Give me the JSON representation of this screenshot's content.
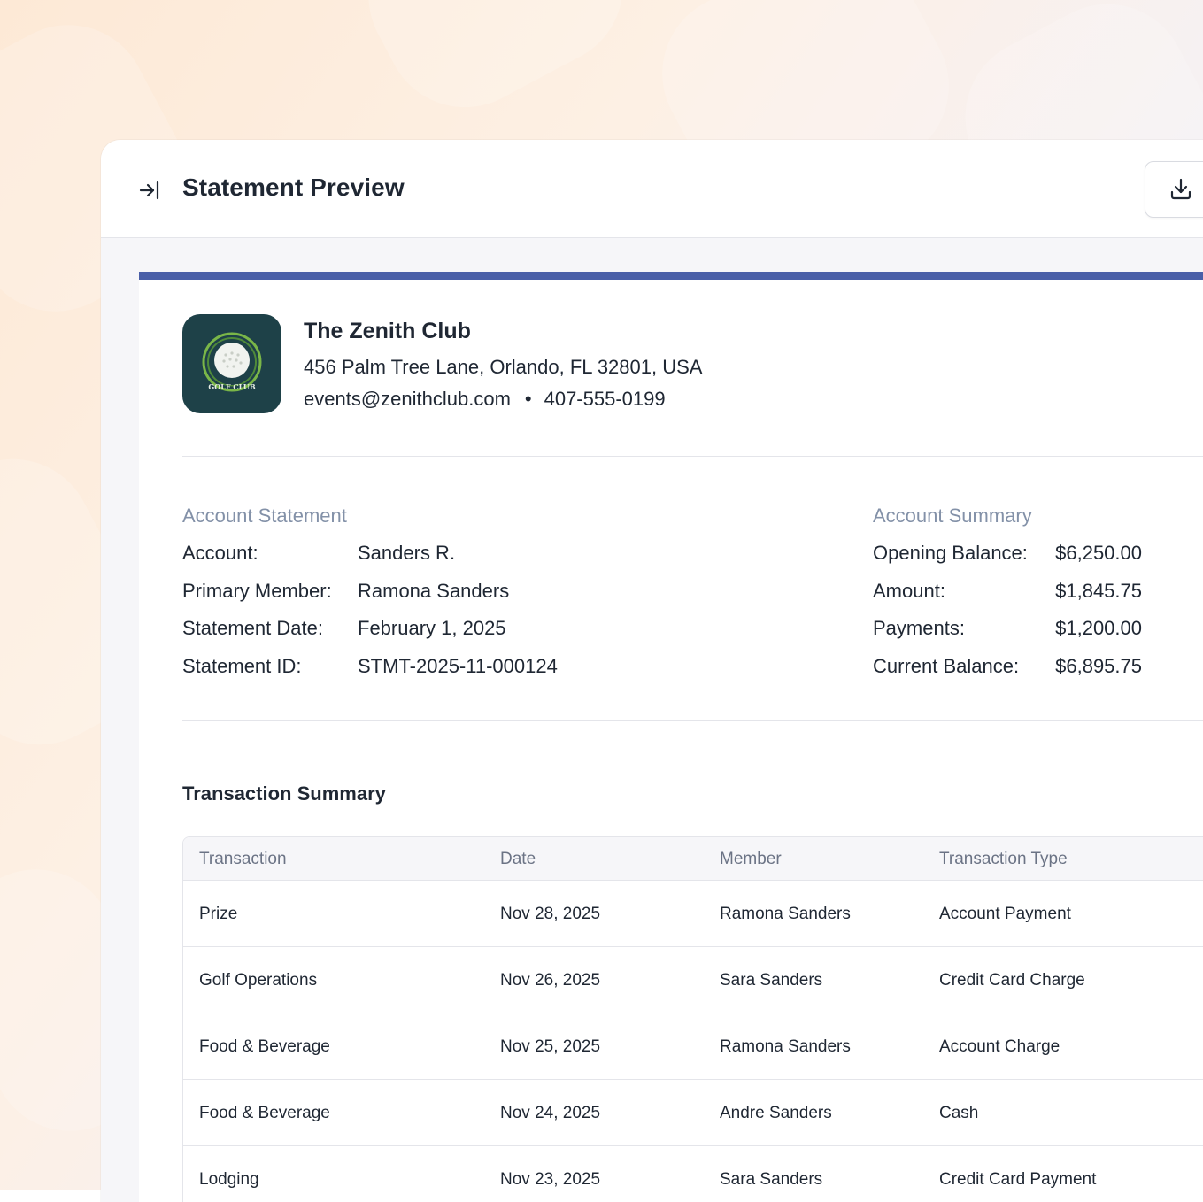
{
  "header": {
    "title": "Statement Preview"
  },
  "club": {
    "name": "The Zenith Club",
    "address": "456 Palm Tree Lane, Orlando, FL 32801, USA",
    "email": "events@zenithclub.com",
    "separator": "•",
    "phone": "407-555-0199",
    "logo_text": "GOLF CLUB"
  },
  "statement": {
    "label": "Account Statement",
    "rows": [
      {
        "key": "Account:",
        "value": "Sanders R."
      },
      {
        "key": "Primary Member:",
        "value": "Ramona Sanders"
      },
      {
        "key": "Statement Date:",
        "value": "February 1, 2025"
      },
      {
        "key": "Statement ID:",
        "value": "STMT-2025-11-000124"
      }
    ]
  },
  "summary": {
    "label": "Account Summary",
    "rows": [
      {
        "key": "Opening Balance:",
        "value": "$6,250.00"
      },
      {
        "key": "Amount:",
        "value": "$1,845.75"
      },
      {
        "key": "Payments:",
        "value": "$1,200.00"
      },
      {
        "key": "Current Balance:",
        "value": "$6,895.75"
      }
    ]
  },
  "transactions": {
    "title": "Transaction Summary",
    "columns": [
      "Transaction",
      "Date",
      "Member",
      "Transaction Type"
    ],
    "rows": [
      {
        "transaction": "Prize",
        "date": "Nov 28, 2025",
        "member": "Ramona Sanders",
        "type": "Account Payment"
      },
      {
        "transaction": "Golf Operations",
        "date": "Nov 26, 2025",
        "member": "Sara Sanders",
        "type": "Credit Card Charge"
      },
      {
        "transaction": "Food & Beverage",
        "date": "Nov 25, 2025",
        "member": "Ramona Sanders",
        "type": "Account Charge"
      },
      {
        "transaction": "Food & Beverage",
        "date": "Nov 24, 2025",
        "member": "Andre Sanders",
        "type": "Cash"
      },
      {
        "transaction": "Lodging",
        "date": "Nov 23, 2025",
        "member": "Sara Sanders",
        "type": "Credit Card Payment"
      }
    ]
  },
  "icons": {
    "collapse": "collapse-right-icon",
    "download": "download-icon"
  },
  "colors": {
    "accent": "#4a5fa8",
    "logo_bg": "#1e4148",
    "muted_label": "#8391a8"
  }
}
